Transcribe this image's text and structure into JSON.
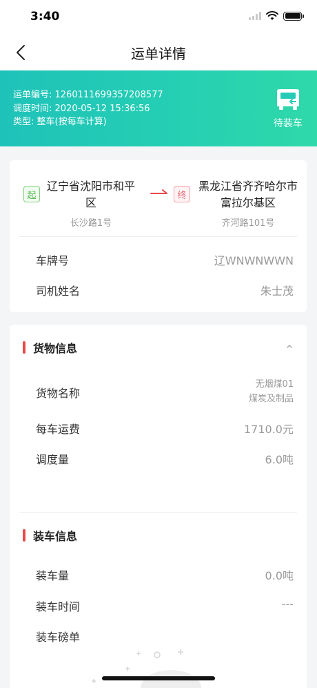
{
  "status_bar": {
    "time": "3:40"
  },
  "nav": {
    "title": "运单详情"
  },
  "banner": {
    "waybill_no": "运单编号: 1260111699357208577",
    "dispatch_time": "调度时间: 2020-05-12 15:36:56",
    "type": "类型: 整车(按每车计算)",
    "status": "待装车"
  },
  "route": {
    "start_tag": "起",
    "start_city": "辽宁省沈阳市和平区",
    "start_street": "长沙路1号",
    "end_tag": "终",
    "end_city": "黑龙江省齐齐哈尔市富拉尔基区",
    "end_street": "齐河路101号"
  },
  "vehicle": {
    "plate_label": "车牌号",
    "plate_value": "辽WNWNWWN",
    "driver_label": "司机姓名",
    "driver_value": "朱士茂"
  },
  "goods": {
    "title": "货物信息",
    "name_label": "货物名称",
    "name_value": "无烟煤01",
    "category_value": "煤炭及制品",
    "freight_label": "每车运费",
    "freight_value": "1710.0元",
    "dispatch_label": "调度量",
    "dispatch_value": "6.0吨"
  },
  "loading": {
    "title": "装车信息",
    "qty_label": "装车量",
    "qty_value": "0.0吨",
    "time_label": "装车时间",
    "time_value": "---",
    "slip_label": "装车磅单"
  },
  "colors": {
    "banner_start": "#1fc2b9",
    "banner_end": "#2fd9a9",
    "section_accent": "#e84a4a",
    "start_tag": "#55b84f",
    "end_tag": "#e56a77"
  }
}
